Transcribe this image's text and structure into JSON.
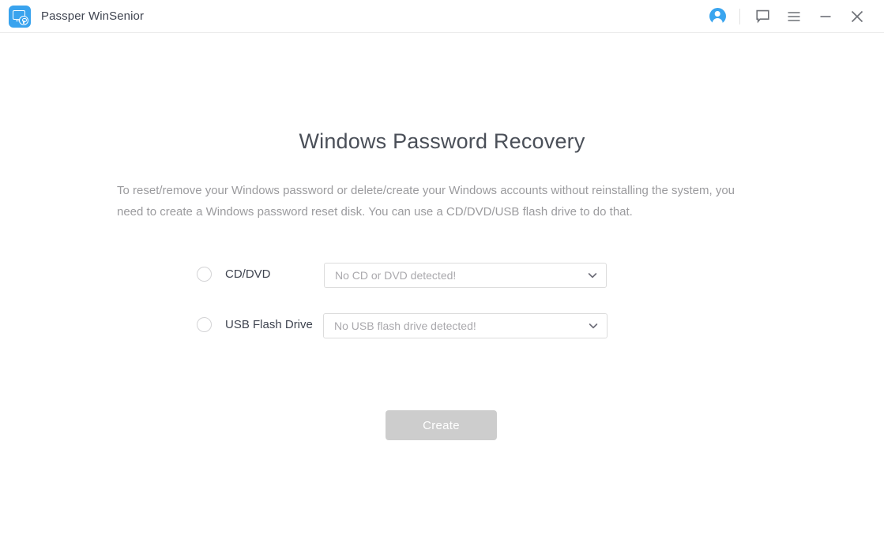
{
  "window": {
    "app_title": "Passper WinSenior",
    "app_icon": "monitor-lock-icon",
    "accent_color": "#39a3ee"
  },
  "titlebar": {
    "account_icon": "user-avatar-icon",
    "feedback_icon": "speech-bubble-icon",
    "menu_icon": "hamburger-menu-icon",
    "minimize_icon": "minimize-icon",
    "close_icon": "close-icon"
  },
  "main": {
    "title": "Windows Password Recovery",
    "description": "To reset/remove your Windows password or delete/create your Windows accounts without reinstalling the system, you need to create a Windows password reset disk. You can use a CD/DVD/USB flash drive to do that.",
    "options": [
      {
        "id": "cd-dvd",
        "label": "CD/DVD",
        "selected": false,
        "select_value": "No CD or DVD detected!",
        "chevron_icon": "chevron-down-icon"
      },
      {
        "id": "usb-flash-drive",
        "label": "USB Flash Drive",
        "selected": false,
        "select_value": "No USB flash drive detected!",
        "chevron_icon": "chevron-down-icon"
      }
    ],
    "create_button": {
      "label": "Create",
      "disabled": true,
      "background": "#cdcdcd",
      "text_color": "#ffffff"
    }
  }
}
